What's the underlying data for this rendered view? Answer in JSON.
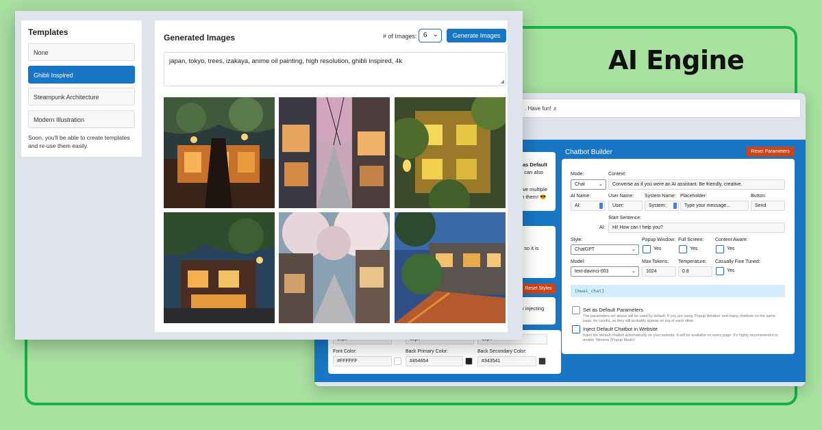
{
  "brand": {
    "title": "AI Engine"
  },
  "templates": {
    "title": "Templates",
    "items": [
      {
        "label": "None",
        "active": false
      },
      {
        "label": "Ghibli Inspired",
        "active": true
      },
      {
        "label": "Steampunk Architecture",
        "active": false
      },
      {
        "label": "Modern Illustration",
        "active": false
      }
    ],
    "note": "Soon, you'll be able to create templates and re-use them easily."
  },
  "images_panel": {
    "title": "Generated Images",
    "num_label": "# of Images:",
    "num_value": "6",
    "generate_label": "Generate Images",
    "prompt": "japan, tokyo, trees, izakaya, anime oil painting, high resolution, ghibli inspired, 4k",
    "image_count": 6
  },
  "chatbot": {
    "notice": ". Have fun! ♬",
    "left_texts": {
      "line1": "as Default",
      "line2": "u can also",
      "line3": "ave multiple",
      "line4": "th them! 😎",
      "line5": ", so it is",
      "line6": "y injecting"
    },
    "reset_styles_label": "Reset Styles",
    "builder_title": "Chatbot Builder",
    "reset_params_label": "Reset Parameters",
    "mode": {
      "label": "Mode:",
      "value": "Chat"
    },
    "context": {
      "label": "Context:",
      "value": "Converse as if you were an AI assistant. Be friendly, creative."
    },
    "ai_name": {
      "label": "AI Name:",
      "value": "AI:"
    },
    "user_name": {
      "label": "User Name:",
      "value": "User:"
    },
    "system_name": {
      "label": "System Name:",
      "value": "System:"
    },
    "placeholder": {
      "label": "Placeholder:",
      "value": "Type your message..."
    },
    "button": {
      "label": "Button:",
      "value": "Send"
    },
    "start_sentence": {
      "label": "Start Sentence:",
      "prefix": "AI:",
      "value": "Hi! How can I help you?"
    },
    "style": {
      "label": "Style:",
      "value": "ChatGPT"
    },
    "popup_window": {
      "label": "Popup Window:",
      "yes": "Yes"
    },
    "full_screen": {
      "label": "Full Screen:",
      "yes": "Yes"
    },
    "content_aware": {
      "label": "Content Aware:",
      "yes": "Yes"
    },
    "model": {
      "label": "Model:",
      "value": "text-davinci-003"
    },
    "max_tokens": {
      "label": "Max Tokens:",
      "value": "1024"
    },
    "temperature": {
      "label": "Temperature:",
      "value": "0.8"
    },
    "fine_tuned": {
      "label": "Casually Fine Tuned:",
      "yes": "Yes"
    },
    "shortcode": "[mwai_chat]",
    "default_params": {
      "label": "Set as Default Parameters",
      "note": "The parameters set above will be used by default. If you are using 'Popup Window' and many chatbots on the same page, be careful, as they will probably appear on top of each other."
    },
    "inject": {
      "label": "Inject Default Chatbot in Website",
      "note": "Inject the default chatbot automatically on your website. It will be available on every page. It's highly recommended to enable 'Window (Popup Mode)'."
    },
    "styles_row": {
      "size1": "15px",
      "size2": "15px",
      "size3": "15px",
      "font_color_label": "Font Color:",
      "font_color": "#FFFFFF",
      "back_primary_label": "Back Primary Color:",
      "back_primary": "#454654",
      "back_secondary_label": "Back Secondary Color:",
      "back_secondary": "#343541"
    }
  },
  "colors": {
    "accent": "#1876c4",
    "reset": "#c8461b",
    "frame": "#14b34a",
    "background": "#a8e0a0"
  }
}
